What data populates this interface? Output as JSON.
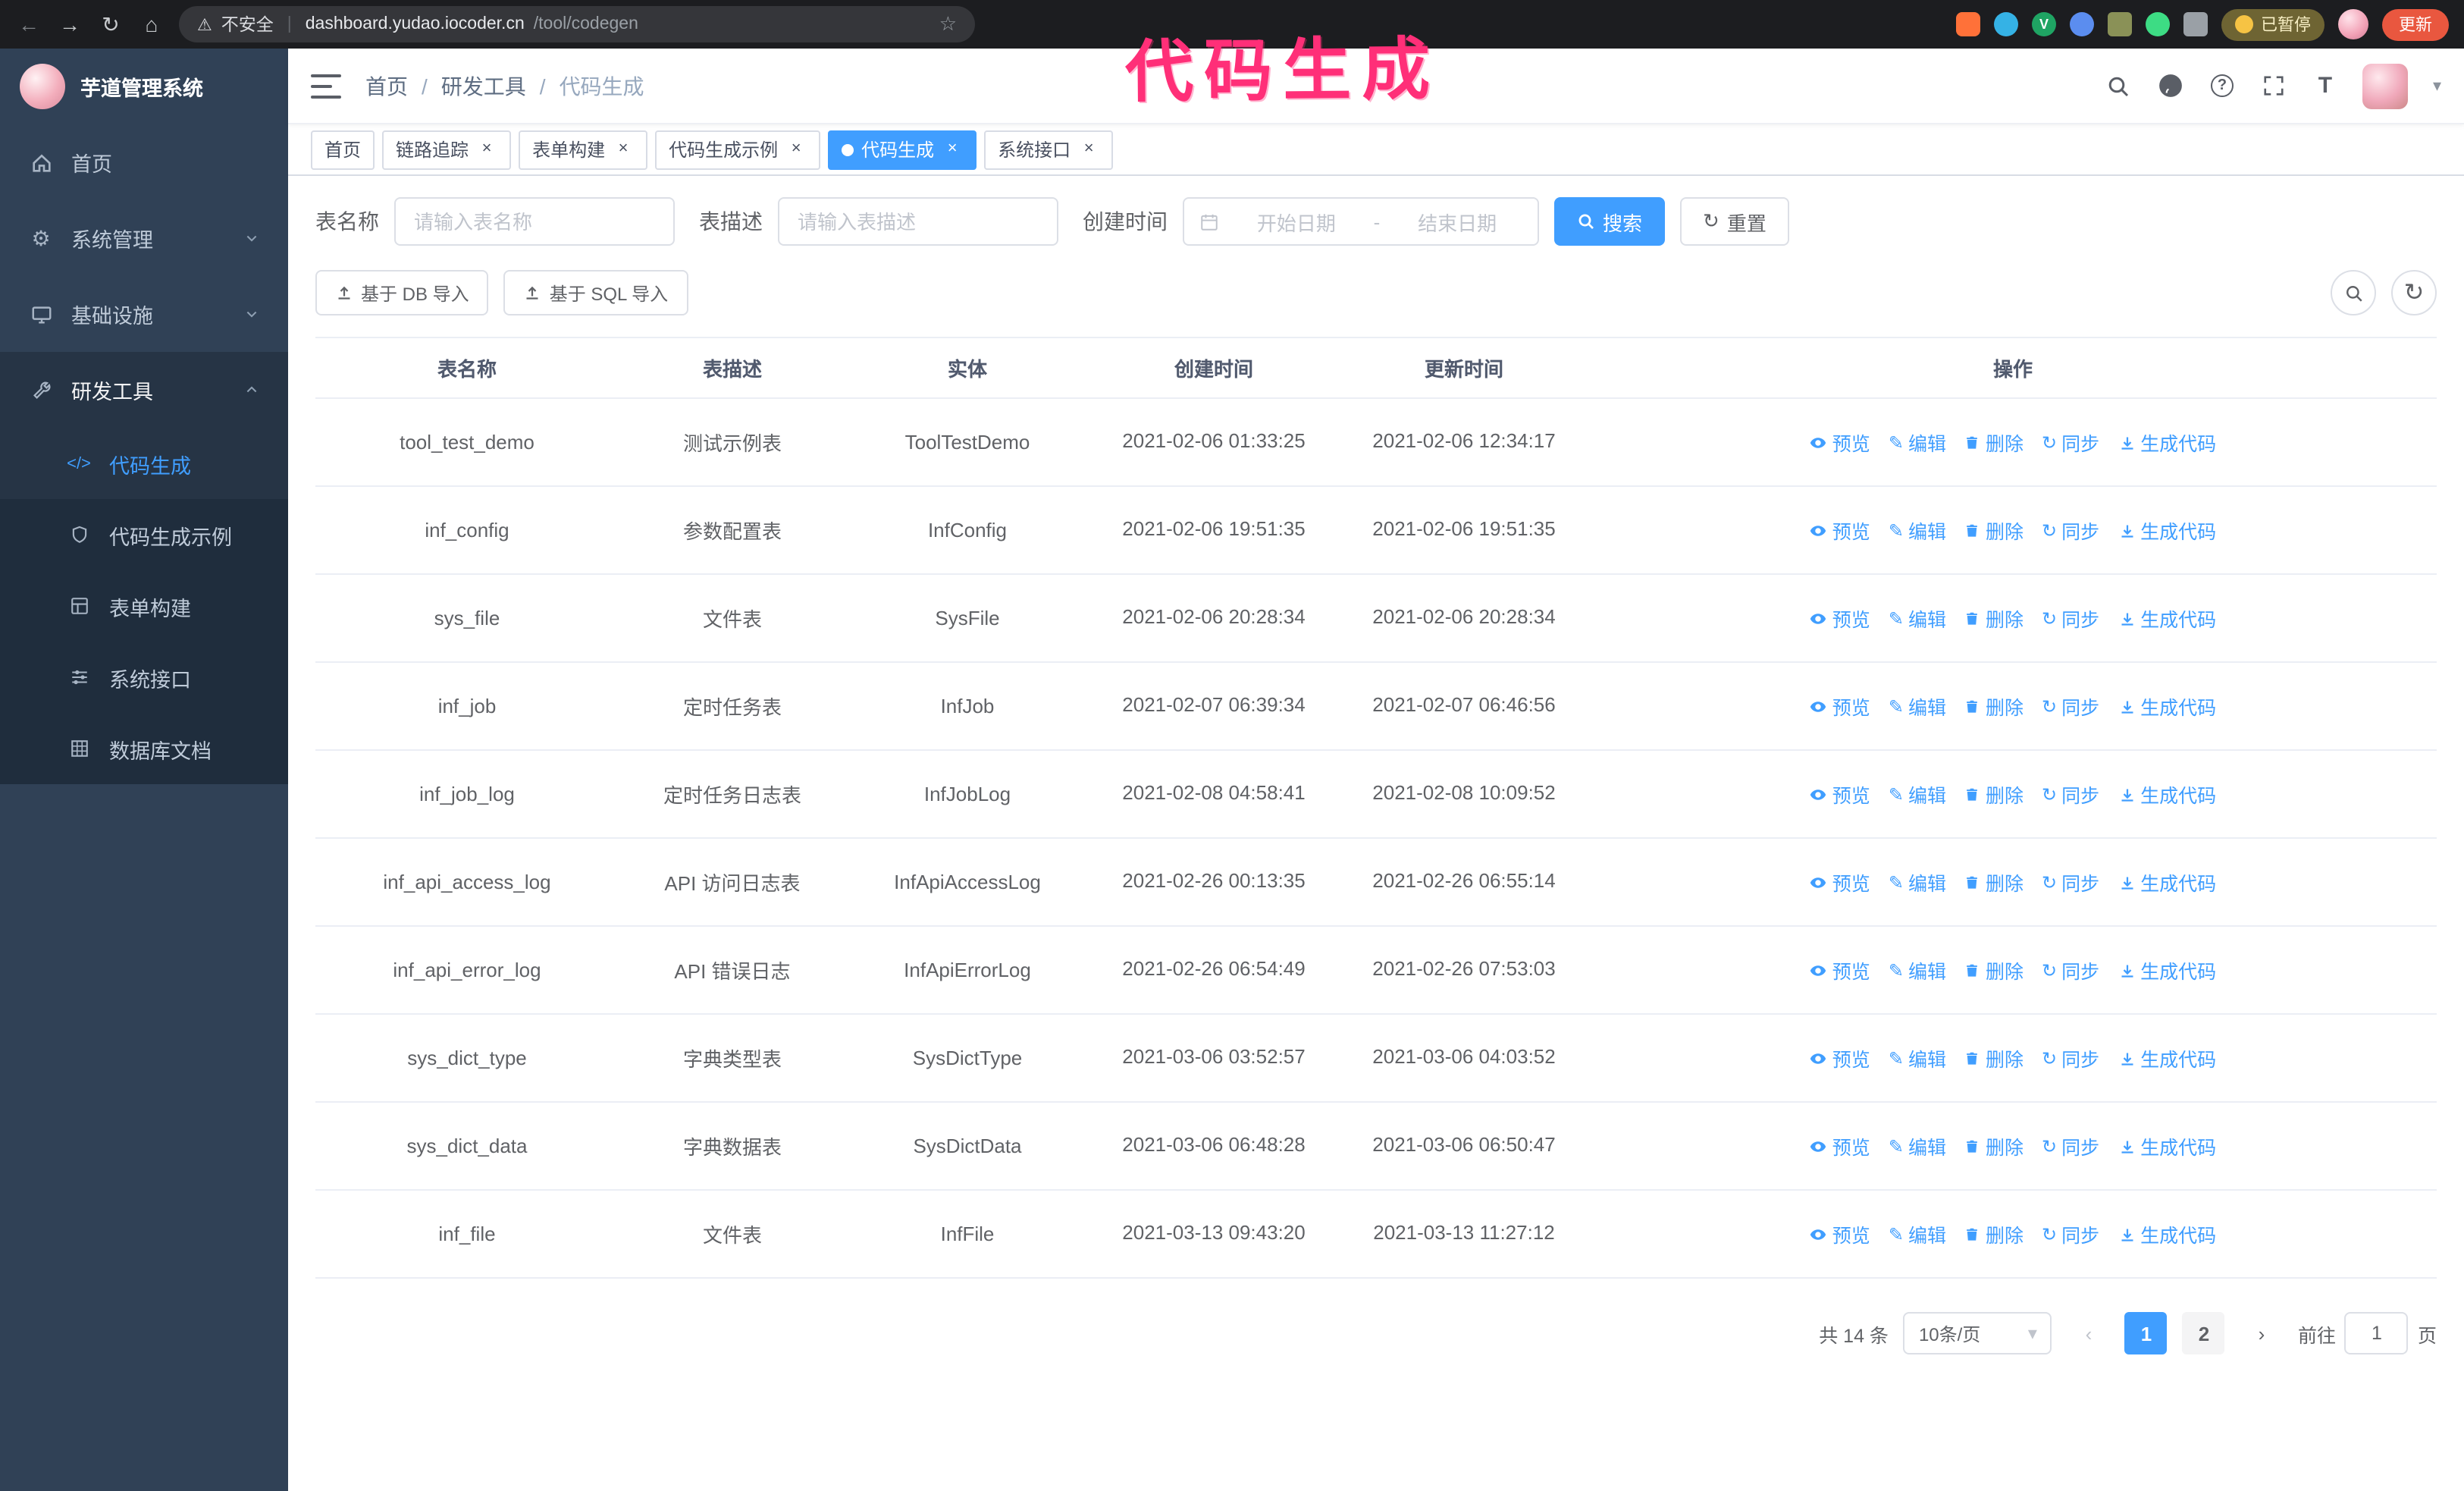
{
  "icons": {
    "back": "←",
    "forward": "→",
    "refresh": "↻",
    "home_browser": "⌂",
    "warning": "⚠",
    "vsep": "|",
    "star": "☆",
    "gear": "⚙",
    "code": "</>",
    "pencil": "✎",
    "caret_down": "▾",
    "close": "×",
    "question": "?",
    "text_size": "T",
    "chevron_left": "‹",
    "chevron_right": "›",
    "ext_v": "V"
  },
  "browser": {
    "security_label": "不安全",
    "url_host": "dashboard.yudao.iocoder.cn",
    "url_path": "/tool/codegen",
    "paused_badge": "已暂停",
    "update_button": "更新"
  },
  "annotation": "代码生成",
  "sidebar": {
    "logo_title": "芋道管理系统",
    "items": [
      {
        "label": "首页"
      },
      {
        "label": "系统管理"
      },
      {
        "label": "基础设施"
      },
      {
        "label": "研发工具"
      }
    ],
    "subitems": [
      {
        "label": "代码生成"
      },
      {
        "label": "代码生成示例"
      },
      {
        "label": "表单构建"
      },
      {
        "label": "系统接口"
      },
      {
        "label": "数据库文档"
      }
    ]
  },
  "header": {
    "breadcrumb": [
      "首页",
      "研发工具",
      "代码生成"
    ],
    "separator": "/"
  },
  "tags": [
    {
      "label": "首页"
    },
    {
      "label": "链路追踪"
    },
    {
      "label": "表单构建"
    },
    {
      "label": "代码生成示例"
    },
    {
      "label": "代码生成"
    },
    {
      "label": "系统接口"
    }
  ],
  "filters": {
    "table_name_label": "表名称",
    "table_name_placeholder": "请输入表名称",
    "table_desc_label": "表描述",
    "table_desc_placeholder": "请输入表描述",
    "create_time_label": "创建时间",
    "date_start_placeholder": "开始日期",
    "date_separator": "-",
    "date_end_placeholder": "结束日期",
    "search_label": "搜索",
    "reset_label": "重置"
  },
  "toolbar": {
    "import_db_label": "基于 DB 导入",
    "import_sql_label": "基于 SQL 导入"
  },
  "table": {
    "columns": [
      "表名称",
      "表描述",
      "实体",
      "创建时间",
      "更新时间",
      "操作"
    ],
    "actions": [
      "预览",
      "编辑",
      "删除",
      "同步",
      "生成代码"
    ],
    "rows": [
      {
        "name": "tool_test_demo",
        "desc": "测试示例表",
        "entity": "ToolTestDemo",
        "created": "2021-02-06 01:33:25",
        "updated": "2021-02-06 12:34:17"
      },
      {
        "name": "inf_config",
        "desc": "参数配置表",
        "entity": "InfConfig",
        "created": "2021-02-06 19:51:35",
        "updated": "2021-02-06 19:51:35"
      },
      {
        "name": "sys_file",
        "desc": "文件表",
        "entity": "SysFile",
        "created": "2021-02-06 20:28:34",
        "updated": "2021-02-06 20:28:34"
      },
      {
        "name": "inf_job",
        "desc": "定时任务表",
        "entity": "InfJob",
        "created": "2021-02-07 06:39:34",
        "updated": "2021-02-07 06:46:56"
      },
      {
        "name": "inf_job_log",
        "desc": "定时任务日志表",
        "entity": "InfJobLog",
        "created": "2021-02-08 04:58:41",
        "updated": "2021-02-08 10:09:52"
      },
      {
        "name": "inf_api_access_log",
        "desc": "API 访问日志表",
        "entity": "InfApiAccessLog",
        "created": "2021-02-26 00:13:35",
        "updated": "2021-02-26 06:55:14"
      },
      {
        "name": "inf_api_error_log",
        "desc": "API 错误日志",
        "entity": "InfApiErrorLog",
        "created": "2021-02-26 06:54:49",
        "updated": "2021-02-26 07:53:03"
      },
      {
        "name": "sys_dict_type",
        "desc": "字典类型表",
        "entity": "SysDictType",
        "created": "2021-03-06 03:52:57",
        "updated": "2021-03-06 04:03:52"
      },
      {
        "name": "sys_dict_data",
        "desc": "字典数据表",
        "entity": "SysDictData",
        "created": "2021-03-06 06:48:28",
        "updated": "2021-03-06 06:50:47"
      },
      {
        "name": "inf_file",
        "desc": "文件表",
        "entity": "InfFile",
        "created": "2021-03-13 09:43:20",
        "updated": "2021-03-13 11:27:12"
      }
    ]
  },
  "pagination": {
    "total": "共 14 条",
    "page_size": "10条/页",
    "pages": [
      "1",
      "2"
    ],
    "goto_label": "前往",
    "goto_value": "1",
    "goto_suffix": "页"
  }
}
